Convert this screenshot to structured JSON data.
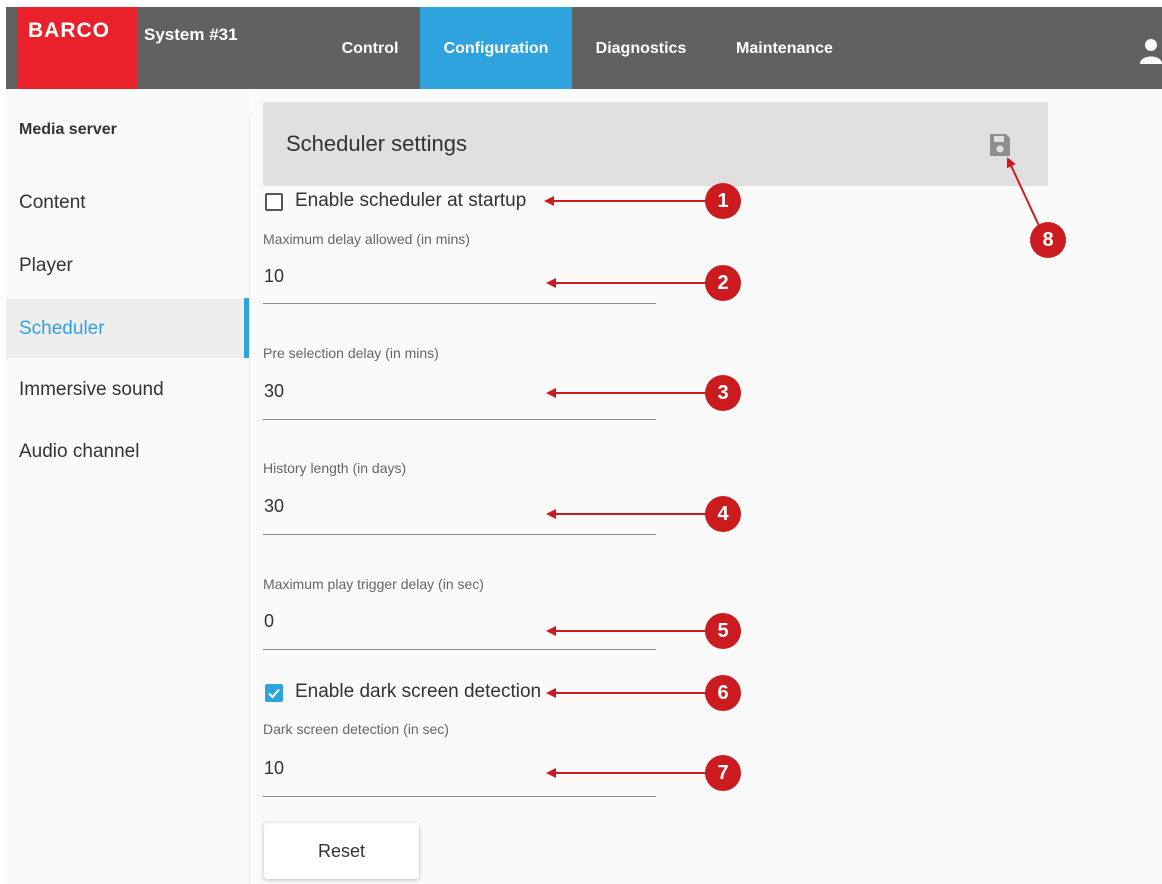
{
  "brand": {
    "logo_text": "BARCO",
    "system_name": "System #31",
    "logo_color": "#e8212a"
  },
  "nav": {
    "tabs": [
      {
        "label": "Control",
        "active": false
      },
      {
        "label": "Configuration",
        "active": true
      },
      {
        "label": "Diagnostics",
        "active": false
      },
      {
        "label": "Maintenance",
        "active": false
      }
    ],
    "user_icon": "user-icon"
  },
  "sidebar": {
    "heading": "Media server",
    "items": [
      {
        "label": "Content",
        "active": false
      },
      {
        "label": "Player",
        "active": false
      },
      {
        "label": "Scheduler",
        "active": true
      },
      {
        "label": "Immersive sound",
        "active": false
      },
      {
        "label": "Audio channel",
        "active": false
      }
    ]
  },
  "panel": {
    "title": "Scheduler settings",
    "save_icon": "save-icon",
    "enable_scheduler": {
      "label": "Enable scheduler at startup",
      "checked": false
    },
    "fields": [
      {
        "label": "Maximum delay allowed (in mins)",
        "value": "10"
      },
      {
        "label": "Pre selection delay (in mins)",
        "value": "30"
      },
      {
        "label": "History length (in days)",
        "value": "30"
      },
      {
        "label": "Maximum play trigger delay (in sec)",
        "value": "0"
      }
    ],
    "dark_screen": {
      "label": "Enable dark screen detection",
      "checked": true
    },
    "dark_screen_field": {
      "label": "Dark screen detection (in sec)",
      "value": "10"
    },
    "reset_label": "Reset"
  },
  "callouts": [
    "1",
    "2",
    "3",
    "4",
    "5",
    "6",
    "7",
    "8"
  ],
  "colors": {
    "accent": "#2fa3de",
    "topbar": "#616161",
    "callout": "#cc1b1f"
  }
}
